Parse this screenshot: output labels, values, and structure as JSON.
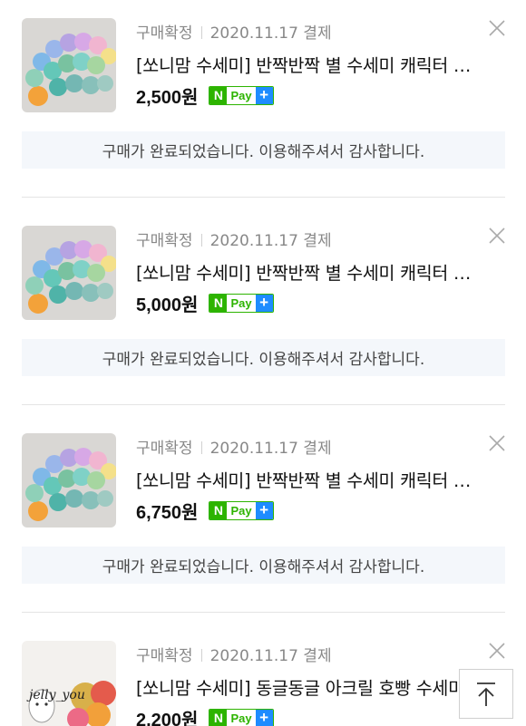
{
  "orders": [
    {
      "status": "구매확정",
      "date": "2020.11.17 결제",
      "title": "[쏘니맘 수세미] 반짝반짝 별 수세미 캐릭터 …",
      "price": "2,500원",
      "pay_badge": {
        "n": "N",
        "pay": "Pay",
        "plus": "+"
      },
      "notice": "구매가 완료되었습니다. 이용해주셔서 감사합니다.",
      "thumbnail_icon": "star-scrubbers-image"
    },
    {
      "status": "구매확정",
      "date": "2020.11.17 결제",
      "title": "[쏘니맘 수세미] 반짝반짝 별 수세미 캐릭터 …",
      "price": "5,000원",
      "pay_badge": {
        "n": "N",
        "pay": "Pay",
        "plus": "+"
      },
      "notice": "구매가 완료되었습니다. 이용해주셔서 감사합니다.",
      "thumbnail_icon": "star-scrubbers-image"
    },
    {
      "status": "구매확정",
      "date": "2020.11.17 결제",
      "title": "[쏘니맘 수세미] 반짝반짝 별 수세미 캐릭터 …",
      "price": "6,750원",
      "pay_badge": {
        "n": "N",
        "pay": "Pay",
        "plus": "+"
      },
      "notice": "구매가 완료되었습니다. 이용해주셔서 감사합니다.",
      "thumbnail_icon": "star-scrubbers-image"
    },
    {
      "status": "구매확정",
      "date": "2020.11.17 결제",
      "title": "[쏘니맘 수세미] 동글동글 아크릴 호빵 수세미",
      "price": "2,200원",
      "pay_badge": {
        "n": "N",
        "pay": "Pay",
        "plus": "+"
      },
      "thumbnail_icon": "jelly-you-logo-image",
      "thumbnail_watermark": "jelly_you"
    }
  ],
  "icons": {
    "close": "close-icon",
    "scroll_top": "arrow-up-icon"
  },
  "colors": {
    "npay_green": "#2db400",
    "npay_blue": "#1e8cff",
    "notice_bg": "#f4f7fb",
    "meta_text": "#888888"
  }
}
